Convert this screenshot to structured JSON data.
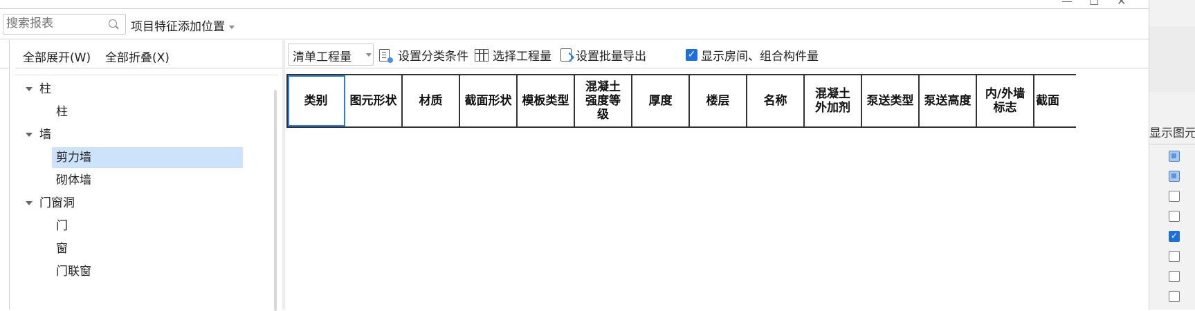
{
  "window_controls": {
    "minimize": "—",
    "maximize": "☐",
    "close": "✕"
  },
  "search": {
    "placeholder": "搜索报表",
    "position_label": "项目特征添加位置"
  },
  "tree": {
    "expand_all": "全部展开(W)",
    "collapse_all": "全部折叠(X)",
    "items": [
      {
        "label": "柱",
        "level": 0,
        "expanded": true
      },
      {
        "label": "柱",
        "level": 1
      },
      {
        "label": "墙",
        "level": 0,
        "expanded": true
      },
      {
        "label": "剪力墙",
        "level": 1,
        "selected": true
      },
      {
        "label": "砌体墙",
        "level": 1
      },
      {
        "label": "门窗洞",
        "level": 0,
        "expanded": true
      },
      {
        "label": "门",
        "level": 1
      },
      {
        "label": "窗",
        "level": 1
      },
      {
        "label": "门联窗",
        "level": 1
      }
    ]
  },
  "toolbar": {
    "combo_value": "清单工程量",
    "set_category": "设置分类条件",
    "select_quantity": "选择工程量",
    "batch_export": "设置批量导出",
    "show_rooms": "显示房间、组合构件量",
    "show_rooms_checked": true
  },
  "grid": {
    "headers": [
      "类别",
      "图元形状",
      "材质",
      "截面形状",
      "模板类型",
      "混凝土强度等级",
      "厚度",
      "楼层",
      "名称",
      "混凝土外加剂",
      "泵送类型",
      "泵送高度",
      "内/外墙标志",
      "截面"
    ]
  },
  "right_panel": {
    "header": "显示图元",
    "checkboxes": [
      "indeterminate",
      "indeterminate",
      "unchecked",
      "unchecked",
      "checked",
      "unchecked",
      "unchecked",
      "unchecked"
    ]
  },
  "colors": {
    "accent": "#1e6fd9",
    "selection": "#cde3fb"
  }
}
